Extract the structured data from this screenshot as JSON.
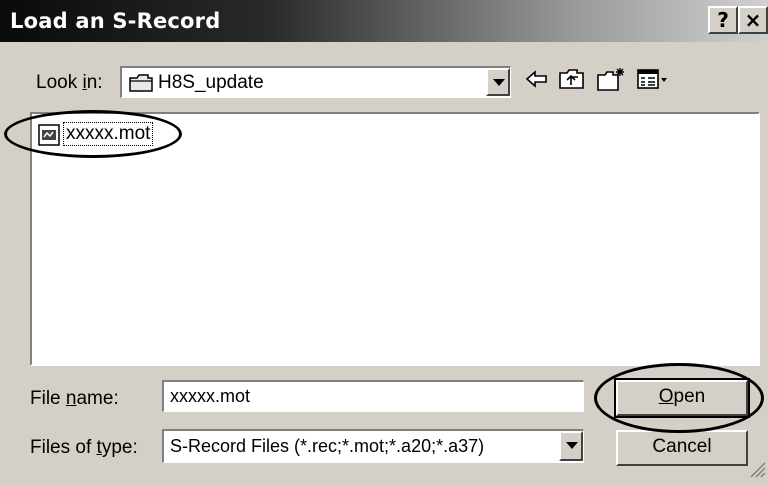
{
  "window": {
    "title": "Load an S-Record",
    "help_glyph": "?",
    "close_glyph": "×"
  },
  "look_in": {
    "label_prefix": "Look ",
    "label_access": "i",
    "label_suffix": "n:",
    "value": "H8S_update",
    "icon": "folder-icon"
  },
  "toolbar": {
    "icons": [
      "back-arrow-icon",
      "up-folder-icon",
      "new-folder-icon",
      "view-menu-icon"
    ]
  },
  "file_list": {
    "items": [
      {
        "name": "xxxxx.mot",
        "icon": "mot-file-icon",
        "selected": true
      }
    ]
  },
  "file_name": {
    "label_prefix": "File ",
    "label_access": "n",
    "label_suffix": "ame:",
    "value": "xxxxx.mot"
  },
  "files_of_type": {
    "label_prefix": "Files of ",
    "label_access": "t",
    "label_suffix": "ype:",
    "value": "S-Record Files (*.rec;*.mot;*.a20;*.a37)"
  },
  "buttons": {
    "open_access": "O",
    "open_rest": "pen",
    "cancel": "Cancel"
  },
  "colors": {
    "title_gradient_start": "#0a0a0a",
    "title_gradient_end": "#d0d0d0",
    "face": "#d4d0c8"
  }
}
